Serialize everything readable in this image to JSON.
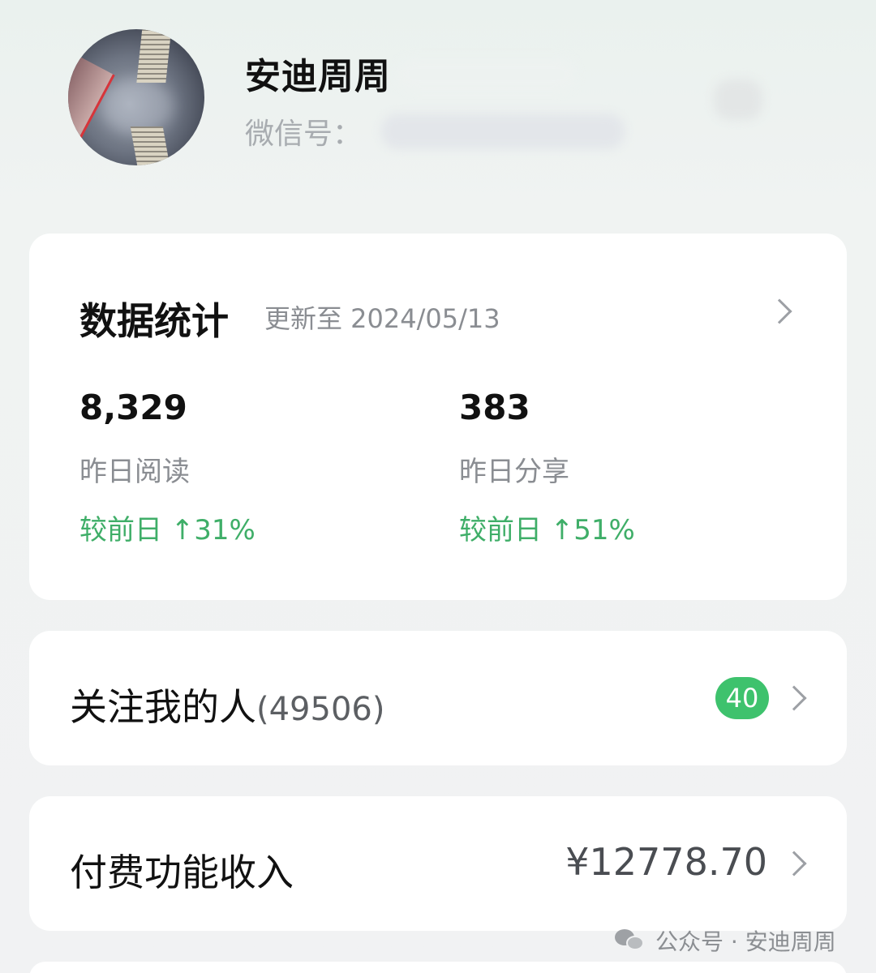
{
  "profile": {
    "name": "安迪周周",
    "wechat_id_label": "微信号："
  },
  "stats": {
    "title": "数据统计",
    "updated": "更新至 2024/05/13",
    "metrics": [
      {
        "value": "8,329",
        "label": "昨日阅读",
        "change": "较前日 ↑31%"
      },
      {
        "value": "383",
        "label": "昨日分享",
        "change": "较前日 ↑51%"
      }
    ]
  },
  "followers": {
    "title": "关注我的人",
    "count": "(49506)",
    "badge": "40"
  },
  "income": {
    "title": "付费功能收入",
    "value": "¥12778.70"
  },
  "watermark": {
    "text": "公众号 · 安迪周周"
  },
  "colors": {
    "accent_green": "#3fae68",
    "badge_green": "#3ec26d",
    "card_bg": "#ffffff",
    "page_bg": "#f1f2f3"
  },
  "icons": [
    "chevron-right-icon",
    "wechat-icon"
  ]
}
